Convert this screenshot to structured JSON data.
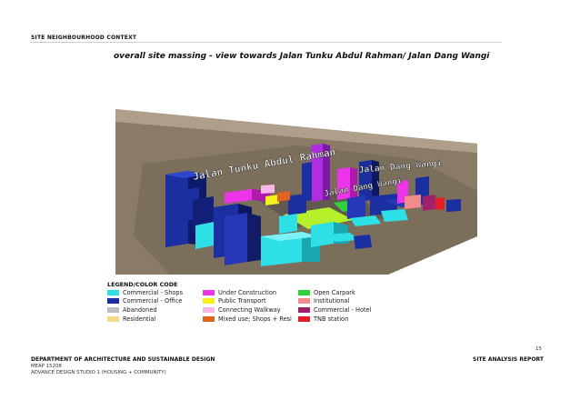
{
  "header": {
    "section": "SITE NEIGHBOURHOOD CONTEXT"
  },
  "figure": {
    "title": "overall site massing - view towards Jalan Tunku Abdul Rahman/ Jalan Dang Wangi",
    "labels": [
      "Jalan Tunku Abdul Rahman",
      "Jalan Dang Wangi",
      "Jalan Dang Wangi"
    ]
  },
  "legend": {
    "title": "LEGEND/COLOR CODE",
    "col1": [
      {
        "label": "Commercial - Shops",
        "color": "#2ee0e6"
      },
      {
        "label": "Commercial - Office",
        "color": "#1c2fa0"
      },
      {
        "label": "Abandoned",
        "color": "#b9bec4"
      },
      {
        "label": "Residential",
        "color": "#f7d98c"
      }
    ],
    "col2": [
      {
        "label": "Under Construction",
        "color": "#ee34ea"
      },
      {
        "label": "Public Transport",
        "color": "#f4f01a"
      },
      {
        "label": "Connecting Walkway",
        "color": "#f7b6e8"
      },
      {
        "label": "Mixed use; Shops + Resi",
        "color": "#e0641e"
      }
    ],
    "col3": [
      {
        "label": "Open Carpark",
        "color": "#2fd23a"
      },
      {
        "label": "Institutional",
        "color": "#f08c8c"
      },
      {
        "label": "Commercial - Hotel",
        "color": "#a0226c"
      },
      {
        "label": "TNB station",
        "color": "#e61e2a"
      }
    ]
  },
  "footer": {
    "page_number": "15",
    "department": "DEPARTMENT OF ARCHITECTURE AND SUSTAINABLE DESIGN",
    "course_code": "MEAP 15208",
    "course_name": "ADVANCE DESIGN STUDIO 1 (HOUSING + COMMUNITY)",
    "report": "SITE ANALYSIS REPORT"
  }
}
